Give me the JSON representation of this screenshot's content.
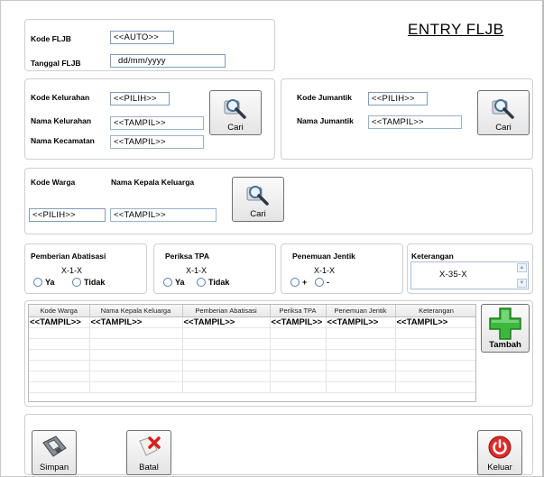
{
  "title": "ENTRY FLJB",
  "header": {
    "kode_fljb_label": "Kode FLJB",
    "kode_fljb_value": "<<AUTO>>",
    "tanggal_fljb_label": "Tanggal FLJB",
    "tanggal_fljb_value": "dd/mm/yyyy"
  },
  "kelurahan": {
    "kode_label": "Kode Kelurahan",
    "kode_value": "<<PILIH>>",
    "nama_label": "Nama Kelurahan",
    "nama_value": "<<TAMPIL>>",
    "kecamatan_label": "Nama Kecamatan",
    "kecamatan_value": "<<TAMPIL>>",
    "button_label": "Cari"
  },
  "jumantik": {
    "kode_label": "Kode Jumantik",
    "kode_value": "<<PILIH>>",
    "nama_label": "Nama Jumantik",
    "nama_value": "<<TAMPIL>>",
    "button_label": "Cari"
  },
  "warga": {
    "kode_label": "Kode Warga",
    "kode_value": "<<PILIH>>",
    "nama_label": "Nama Kepala Keluarga",
    "nama_value": "<<TAMPIL>>",
    "button_label": "Cari"
  },
  "abatisasi": {
    "label": "Pemberian Abatisasi",
    "value": "X-1-X",
    "option_yes": "Ya",
    "option_no": "Tidak"
  },
  "tpa": {
    "label": "Periksa TPA",
    "value": "X-1-X",
    "option_yes": "Ya",
    "option_no": "Tidak"
  },
  "jentik": {
    "label": "Penemuan Jentik",
    "value": "X-1-X",
    "option_plus": "+",
    "option_minus": "-"
  },
  "keterangan": {
    "label": "Keterangan",
    "value": "X-35-X"
  },
  "grid": {
    "columns": [
      "Kode Warga",
      "Nama Kepala Keluarga",
      "Pemberian Abatisasi",
      "Periksa TPA",
      "Penemuan Jentik",
      "Keterangan"
    ],
    "row": [
      "<<TAMPIL>>",
      "<<TAMPIL>>",
      "<<TAMPIL>>",
      "<<TAMPIL>>",
      "<<TAMPIL>>",
      "<<TAMPIL>>"
    ]
  },
  "buttons": {
    "tambah": "Tambah",
    "simpan": "Simpan",
    "batal": "Batal",
    "keluar": "Keluar"
  },
  "icons": {
    "cari": "magnifier-icon",
    "tambah": "green-plus-icon",
    "simpan": "floppy-disk-icon",
    "batal": "red-x-document-icon",
    "keluar": "power-icon"
  }
}
